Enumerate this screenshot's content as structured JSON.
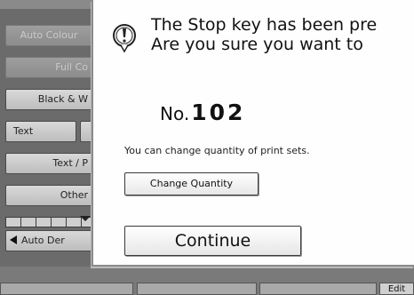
{
  "panel": {
    "buttons": [
      {
        "label": "Auto Colour",
        "disabled": true
      },
      {
        "label": "Full Co",
        "disabled": true
      },
      {
        "label": "Black & W",
        "disabled": false
      },
      {
        "label": "Text",
        "disabled": false
      },
      {
        "label": "Text / P",
        "disabled": false
      },
      {
        "label": "Other",
        "disabled": false
      },
      {
        "label": "Auto Der",
        "disabled": false
      }
    ],
    "bottom_label": "Edit"
  },
  "dialog": {
    "icon": "warning-icon",
    "message_line1": "The Stop key has been pre",
    "message_line2": "Are you sure you want to",
    "job_prefix": "No.",
    "job_number": "102",
    "hint": "You can change quantity of print sets.",
    "change_quantity_label": "Change Quantity",
    "continue_label": "Continue"
  },
  "colors": {
    "panel_bg": "#6b6b6b",
    "dialog_bg": "#fefefe",
    "button_face": "#d9d9d9"
  }
}
